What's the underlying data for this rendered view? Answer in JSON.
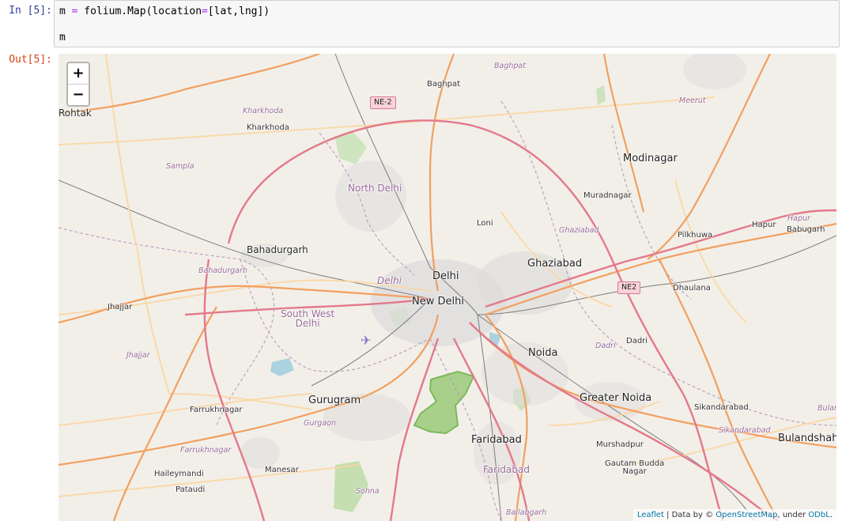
{
  "cell": {
    "in_prompt": "In [5]:",
    "out_prompt": "Out[5]:",
    "code_line1": {
      "a": "m ",
      "op1": "=",
      "b": " folium.Map(location",
      "op2": "=",
      "c": "[lat,lng])"
    },
    "code_line2": "m"
  },
  "map": {
    "zoom_in_label": "+",
    "zoom_out_label": "−",
    "highway_shields": [
      "NE-2",
      "NE2"
    ],
    "places": {
      "rohtak": "Rohtak",
      "kharkhoda": "Kharkhoda",
      "kharkhoda_district": "Kharkhoda",
      "baghpat": "Baghpat",
      "baghpat_district": "Baghpat",
      "meerut_district": "Meerut",
      "modinagar": "Modinagar",
      "muradnagar": "Muradnagar",
      "sampla_district": "Sampla",
      "north_delhi": "North Delhi",
      "loni": "Loni",
      "ghaziabad_district": "Ghaziabad",
      "hapur_district": "Hapur",
      "hapur": "Hapur",
      "babugarh": "Babugarh",
      "pilkhuwa": "Pilkhuwa",
      "bahadurgarh": "Bahadurgarh",
      "bahadurgarh_district": "Bahadurgarh",
      "delhi": "Delhi",
      "delhi_district": "Delhi",
      "ghaziabad": "Ghaziabad",
      "dhaulana": "Dhaulana",
      "new_delhi": "New Delhi",
      "jhajjar": "Jhajjar",
      "south_west_delhi": "South West\nDelhi",
      "jhajjar_district": "Jhajjar",
      "dadri": "Dadri",
      "dadri_district": "Dadri",
      "noida": "Noida",
      "gurugram": "Gurugram",
      "greater_noida": "Greater Noida",
      "farrukhnagar": "Farrukhnagar",
      "sikandarabad": "Sikandarabad",
      "sikandarabad_district": "Sikandarabad",
      "bulan_district": "Bular",
      "gurgaon_district": "Gurgaon",
      "faridabad": "Faridabad",
      "bulandshahr": "Bulandshah",
      "farrukhnagar_district": "Farrukhnagar",
      "murshadpur": "Murshadpur",
      "haileymandi": "Haileymandi",
      "manesar": "Manesar",
      "gautam_budda_nagar": "Gautam Budda\nNagar",
      "faridabad_district": "Faridabad",
      "pataudi": "Pataudi",
      "sohna_district": "Sohna",
      "ballabgarh_district": "Ballabgarh",
      "hapur_top": "Hapur"
    },
    "attribution": {
      "leaflet": "Leaflet",
      "sep": " | Data by © ",
      "osm": "OpenStreetMap",
      "under": ", under ",
      "odbl": "ODbL",
      "dot": "."
    }
  }
}
